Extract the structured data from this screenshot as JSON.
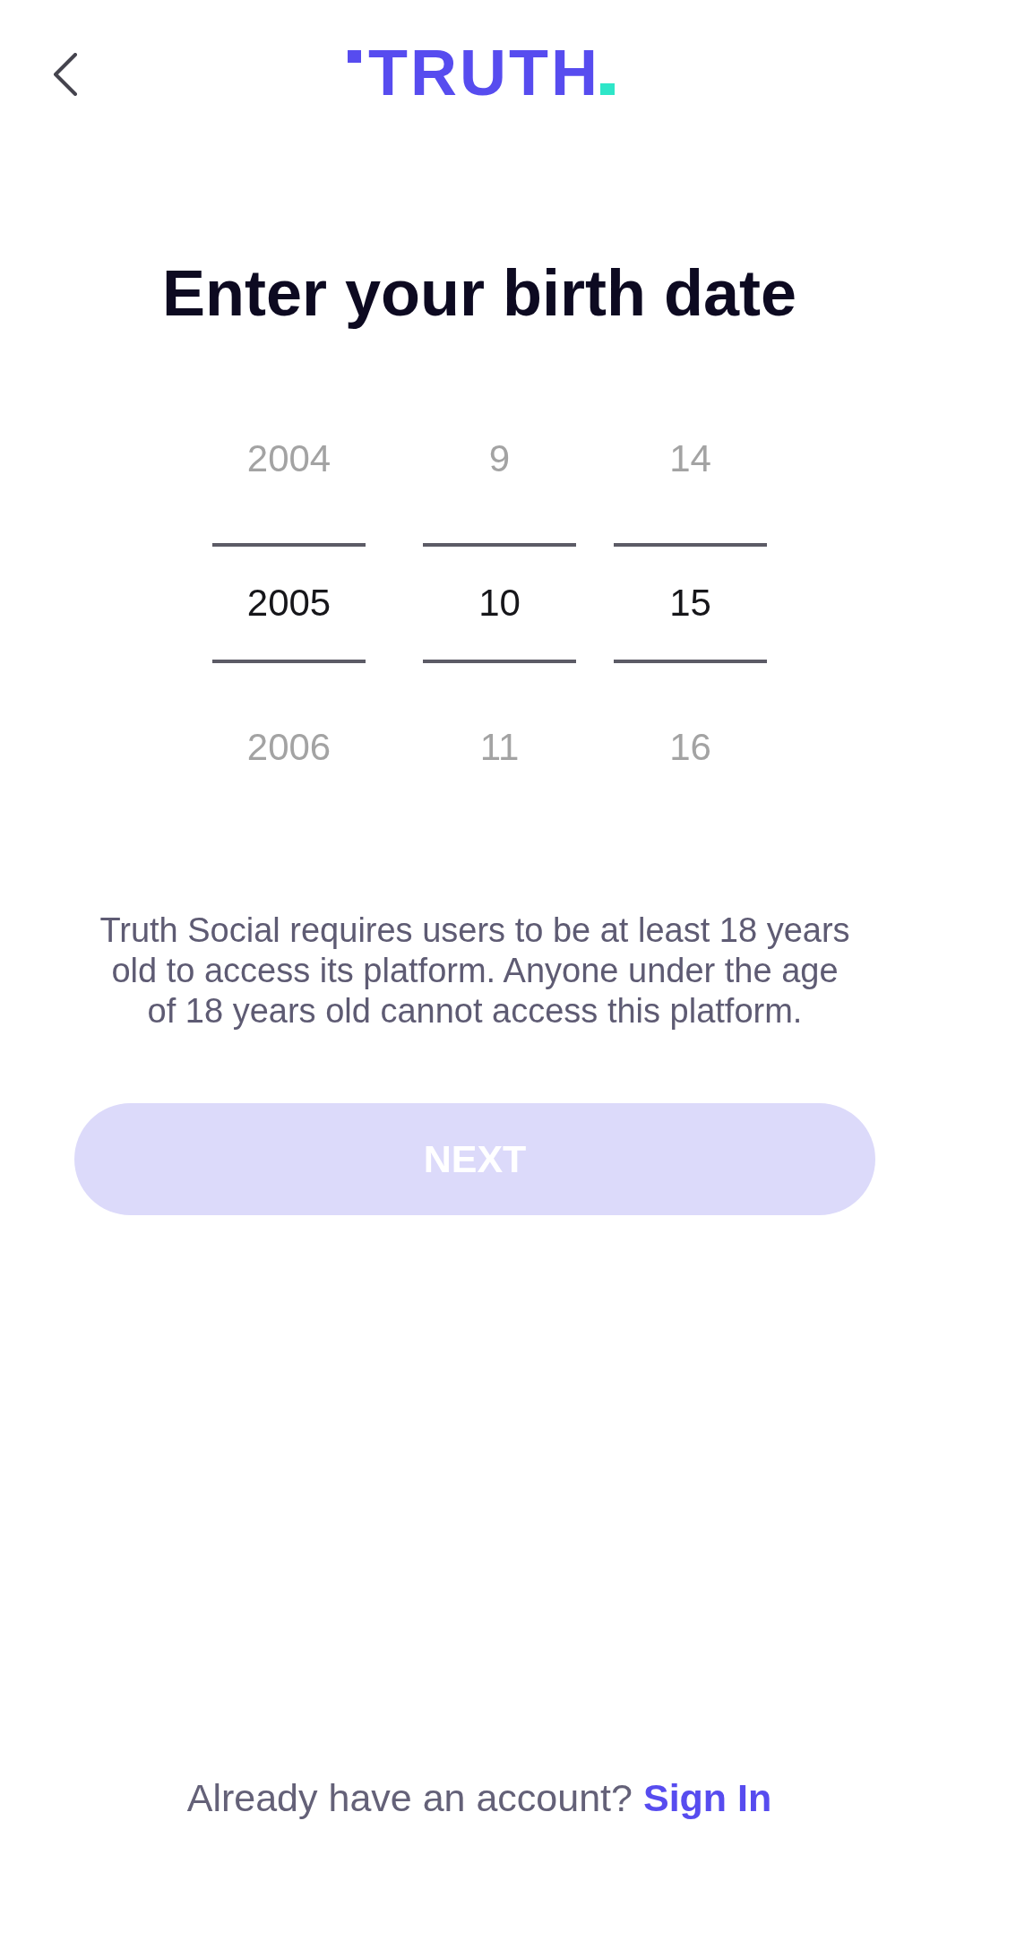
{
  "logo": {
    "text": "TRUTH"
  },
  "title": "Enter your birth date",
  "picker": {
    "columns": [
      {
        "items": [
          {
            "value": "2004",
            "selected": false
          },
          {
            "value": "2005",
            "selected": true
          },
          {
            "value": "2006",
            "selected": false
          }
        ]
      },
      {
        "items": [
          {
            "value": "9",
            "selected": false
          },
          {
            "value": "10",
            "selected": true
          },
          {
            "value": "11",
            "selected": false
          }
        ]
      },
      {
        "items": [
          {
            "value": "14",
            "selected": false
          },
          {
            "value": "15",
            "selected": true
          },
          {
            "value": "16",
            "selected": false
          }
        ]
      }
    ]
  },
  "notice": "Truth Social requires users to be at least 18 years old to access its platform. Anyone under the age of 18 years old cannot access this platform.",
  "next_button": {
    "label": "NEXT",
    "disabled": true
  },
  "footer": {
    "prompt": "Already have an account?",
    "link": "Sign In"
  }
}
